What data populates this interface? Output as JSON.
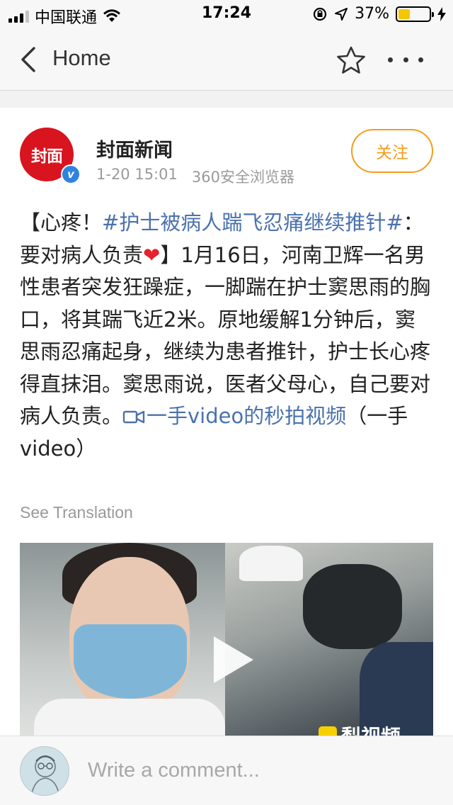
{
  "status_bar": {
    "carrier": "中国联通",
    "time": "17:24",
    "battery_percent": "37%",
    "battery_level": 0.37
  },
  "nav": {
    "back_label": "Home"
  },
  "post": {
    "author": "封面新闻",
    "avatar_text": "封面",
    "verified_badge": "v",
    "date": "1-20 15:01",
    "source": "360安全浏览器",
    "follow_label": "关注",
    "text_parts": {
      "p1": "【心疼！",
      "topic": "#护士被病人踹飞忍痛继续推针#",
      "p2": "：要对病人负责",
      "heart": "❤",
      "p3": "】1月16日，河南卫辉一名男性患者突发狂躁症，一脚踹在护士窦思雨的胸口，将其踹飞近2米。原地缓解1分钟后，窦思雨忍痛起身，继续为患者推针，护士长心疼得直抹泪。窦思雨说，医者父母心，自己要对病人负责。",
      "link": "一手video的秒拍视频",
      "p4": "（一手video）"
    },
    "see_translation": "See Translation",
    "video_watermark": "梨视频"
  },
  "comment_bar": {
    "placeholder": "Write a comment..."
  },
  "colors": {
    "accent_orange": "#f39c1d",
    "link_blue": "#4a72ad",
    "brand_red": "#d8141f",
    "verified_blue": "#2f83e0"
  }
}
